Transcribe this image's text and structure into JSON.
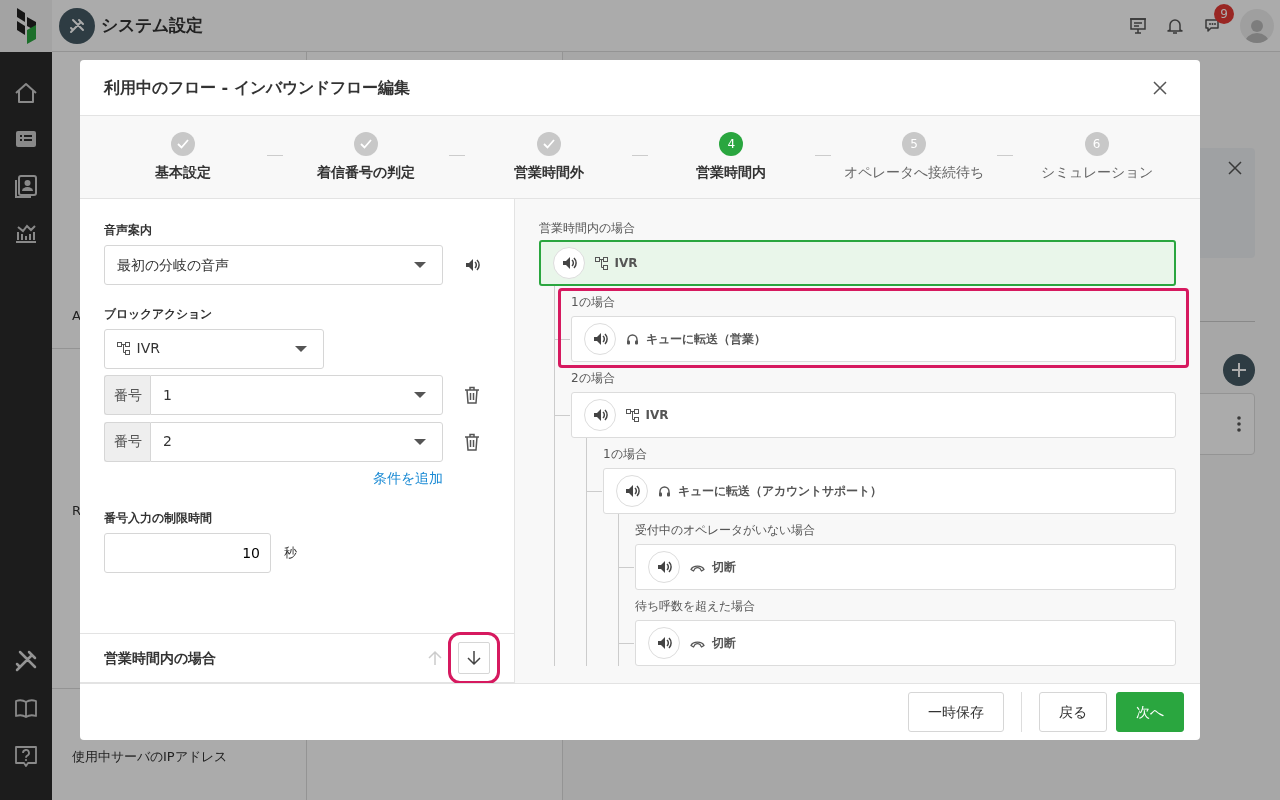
{
  "app": {
    "title": "システム設定",
    "notification_count": "9"
  },
  "subnav": [
    {
      "items": [
        {
          "text": "A",
          "selected": false
        }
      ]
    },
    {
      "items": [
        {
          "text": "R",
          "selected": false
        }
      ]
    },
    {
      "items": [
        {
          "text": "使用中サーバのIPアドレス",
          "selected": false
        }
      ]
    }
  ],
  "modal": {
    "title": "利用中のフロー - インバウンドフロー編集",
    "steps": [
      {
        "label": "基本設定",
        "done": true,
        "selected": false
      },
      {
        "label": "着信番号の判定",
        "done": true,
        "selected": false
      },
      {
        "label": "営業時間外",
        "done": true,
        "selected": false
      },
      {
        "label": "営業時間内",
        "done": false,
        "selected": true,
        "number": "4"
      },
      {
        "label": "オペレータへ接続待ち",
        "done": false,
        "selected": false,
        "number": "5"
      },
      {
        "label": "シミュレーション",
        "done": false,
        "selected": false,
        "number": "6"
      }
    ],
    "form": {
      "voice_label": "音声案内",
      "voice_value": "最初の分岐の音声",
      "action_label": "ブロックアクション",
      "action": {
        "kind": "ivr",
        "label": "IVR"
      },
      "conditions": [
        {
          "prefix": "番号",
          "value": "1"
        },
        {
          "prefix": "番号",
          "value": "2"
        }
      ],
      "add_condition": "条件を追加",
      "timeout_label": "番号入力の制限時間",
      "timeout_value": "10",
      "timeout_unit": "秒"
    },
    "section": {
      "title": "営業時間内の場合",
      "move_up_disabled": true,
      "move_down_highlighted": true
    },
    "tree": {
      "label": "営業時間内の場合",
      "node": {
        "kind": "ivr",
        "label": "IVR",
        "selected": true,
        "children": [
          {
            "label": "1の場合",
            "highlighted": true,
            "node": {
              "kind": "queue",
              "label": "キューに転送（営業）",
              "selected": false
            }
          },
          {
            "label": "2の場合",
            "highlighted": false,
            "node": {
              "kind": "ivr",
              "label": "IVR",
              "selected": false,
              "children": [
                {
                  "label": "1の場合",
                  "highlighted": false,
                  "node": {
                    "kind": "queue",
                    "label": "キューに転送（アカウントサポート）",
                    "selected": false,
                    "children": [
                      {
                        "label": "受付中のオペレータがいない場合",
                        "highlighted": false,
                        "node": {
                          "kind": "hangup",
                          "label": "切断",
                          "selected": false
                        }
                      },
                      {
                        "label": "待ち呼数を超えた場合",
                        "highlighted": false,
                        "node": {
                          "kind": "hangup",
                          "label": "切断",
                          "selected": false
                        }
                      }
                    ]
                  }
                }
              ]
            }
          }
        ]
      }
    },
    "buttons": [
      {
        "label": "一時保存",
        "kind": "draft"
      },
      {
        "label": "戻る",
        "kind": "back"
      },
      {
        "label": "次へ",
        "kind": "next"
      }
    ]
  }
}
